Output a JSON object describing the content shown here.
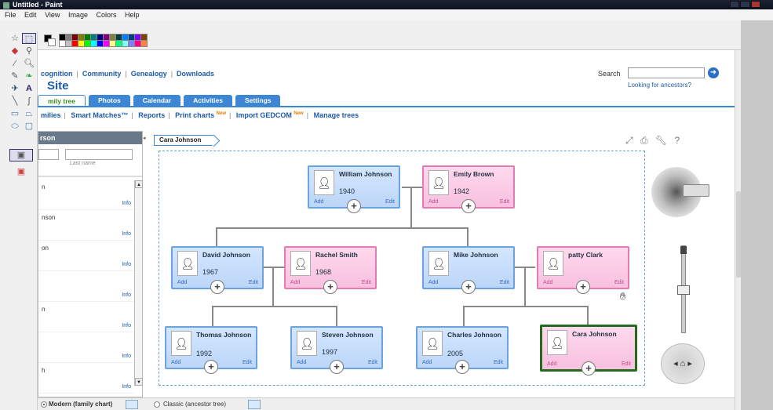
{
  "window": {
    "title": "Untitled - Paint"
  },
  "menu": [
    "File",
    "Edit",
    "View",
    "Image",
    "Colors",
    "Help"
  ],
  "palette_colors": [
    "#000000",
    "#808080",
    "#800000",
    "#808000",
    "#008000",
    "#008080",
    "#000080",
    "#800080",
    "#808040",
    "#004040",
    "#0080ff",
    "#004080",
    "#8000ff",
    "#804000",
    "#ffffff",
    "#c0c0c0",
    "#ff0000",
    "#ffff00",
    "#00ff00",
    "#00ffff",
    "#0000ff",
    "#ff00ff",
    "#ffff80",
    "#00ff80",
    "#80ffff",
    "#8080ff",
    "#ff0080",
    "#ff8040"
  ],
  "site": {
    "top_links": [
      "cognition",
      "Community",
      "Genealogy",
      "Downloads"
    ],
    "title": "Site",
    "search_label": "Search",
    "search_value": "",
    "looking_link": "Looking for ancestors?",
    "tabs": [
      "mily tree",
      "Photos",
      "Calendar",
      "Activities",
      "Settings"
    ],
    "sub_links": [
      {
        "label": "milies",
        "new": ""
      },
      {
        "label": "Smart Matches™",
        "new": ""
      },
      {
        "label": "Reports",
        "new": ""
      },
      {
        "label": "Print charts",
        "new": "New"
      },
      {
        "label": "Import GEDCOM",
        "new": "New"
      },
      {
        "label": "Manage trees",
        "new": ""
      }
    ]
  },
  "left_panel": {
    "header": "rson",
    "last_name_placeholder": "Last name",
    "rows": [
      {
        "name": "n",
        "info": "Info"
      },
      {
        "name": "nson",
        "info": "Info"
      },
      {
        "name": "on",
        "info": "Info"
      },
      {
        "name": "",
        "info": "Info"
      },
      {
        "name": "n",
        "info": "Info"
      },
      {
        "name": "",
        "info": "Info"
      },
      {
        "name": "h",
        "info": "Info"
      }
    ]
  },
  "breadcrumb": "Cara Johnson",
  "people": [
    {
      "id": "william",
      "name": "William Johnson",
      "year": "1940",
      "gender": "m",
      "add": "Add",
      "edit": "Edit"
    },
    {
      "id": "emily",
      "name": "Emily Brown",
      "year": "1942",
      "gender": "f",
      "add": "Add",
      "edit": "Edit"
    },
    {
      "id": "david",
      "name": "David Johnson",
      "year": "1967",
      "gender": "m",
      "add": "Add",
      "edit": "Edit"
    },
    {
      "id": "rachel",
      "name": "Rachel Smith",
      "year": "1968",
      "gender": "f",
      "add": "Add",
      "edit": "Edit"
    },
    {
      "id": "mike",
      "name": "Mike Johnson",
      "year": "",
      "gender": "m",
      "add": "Add",
      "edit": "Edit"
    },
    {
      "id": "patty",
      "name": "patty Clark",
      "year": "",
      "gender": "f",
      "add": "Add",
      "edit": "Edit"
    },
    {
      "id": "thomas",
      "name": "Thomas Johnson",
      "year": "1992",
      "gender": "m",
      "add": "Add",
      "edit": "Edit"
    },
    {
      "id": "steven",
      "name": "Steven Johnson",
      "year": "1997",
      "gender": "m",
      "add": "Add",
      "edit": "Edit"
    },
    {
      "id": "charles",
      "name": "Charles Johnson",
      "year": "2005",
      "gender": "m",
      "add": "Add",
      "edit": "Edit"
    },
    {
      "id": "cara",
      "name": "Cara Johnson",
      "year": "",
      "gender": "f",
      "add": "Add",
      "edit": "Edit",
      "selected": true
    }
  ],
  "bottom": {
    "modern_label": "Modern (family chart)",
    "classic_label": "Classic (ancestor tree)"
  }
}
